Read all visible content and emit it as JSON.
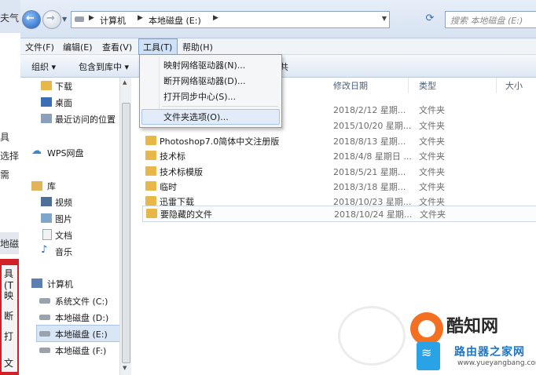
{
  "background_window": {
    "fragments": [
      "夫气",
      "具",
      "选择",
      "需",
      "地磁",
      "具(T",
      "映",
      "断",
      "打",
      "文"
    ]
  },
  "address_bar": {
    "crumbs": [
      "计算机",
      "本地磁盘 (E:)"
    ],
    "search_placeholder": "搜索 本地磁盘 (E:)"
  },
  "menubar": {
    "items": [
      "文件(F)",
      "编辑(E)",
      "查看(V)",
      "工具(T)",
      "帮助(H)"
    ]
  },
  "toolbar": {
    "organize": "组织 ▾",
    "include_library": "包含到库中 ▾",
    "trailing": "共"
  },
  "nav": {
    "favorites": [
      "下载",
      "桌面",
      "最近访问的位置"
    ],
    "wps": "WPS网盘",
    "library": "库",
    "library_items": [
      "视频",
      "图片",
      "文档",
      "音乐"
    ],
    "computer": "计算机",
    "drives": [
      "系统文件 (C:)",
      "本地磁盘 (D:)",
      "本地磁盘 (E:)",
      "本地磁盘 (F:)"
    ]
  },
  "columns": {
    "date": "修改日期",
    "type": "类型",
    "size": "大小"
  },
  "files": [
    {
      "name": "",
      "date": "2018/2/12 星期...",
      "type": "文件夹"
    },
    {
      "name": "",
      "date": "2015/10/20 星期...",
      "type": "文件夹"
    },
    {
      "name": "Photoshop7.0简体中文注册版",
      "date": "2018/8/13 星期...",
      "type": "文件夹"
    },
    {
      "name": "技术标",
      "date": "2018/4/8 星期日 ...",
      "type": "文件夹"
    },
    {
      "name": "技术标模版",
      "date": "2018/5/21 星期...",
      "type": "文件夹"
    },
    {
      "name": "临时",
      "date": "2018/3/18 星期...",
      "type": "文件夹"
    },
    {
      "name": "迅雷下载",
      "date": "2018/10/23 星期...",
      "type": "文件夹"
    },
    {
      "name": "要隐藏的文件",
      "date": "2018/10/24 星期...",
      "type": "文件夹"
    }
  ],
  "tools_menu": {
    "items": [
      "映射网络驱动器(N)...",
      "断开网络驱动器(D)...",
      "打开同步中心(S)...",
      "文件夹选项(O)..."
    ]
  },
  "watermark": {
    "brand1": "酷知网",
    "brand2": "路由器之家网",
    "url": "www.yueyangbang.com"
  }
}
